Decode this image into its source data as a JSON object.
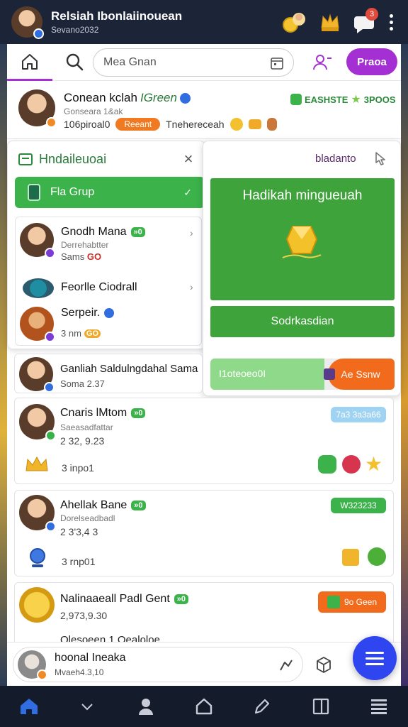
{
  "header": {
    "title": "Relsiah Ibonlaiinouean",
    "subtitle": "Sevano2032",
    "notification_count": "3"
  },
  "search": {
    "placeholder": "Mea Gnan",
    "primary_button": "Praoa"
  },
  "profile": {
    "name": "Conean kclah",
    "name_accent": "IGreen",
    "sub": "Gonseara 1&ak",
    "stats": "106piroal0",
    "badge": "Reeant",
    "extra": "Tnehereceah",
    "right_tag_1": "EASHSTE",
    "right_tag_2": "3POOS"
  },
  "group_popup": {
    "title": "Hndaileuoai",
    "group_button": "Fla Grup",
    "members": [
      {
        "name": "Gnodh Mana",
        "tag": "»0",
        "sub1": "Derrehabtter",
        "sub2": "Sams",
        "sub2_accent": "GO"
      },
      {
        "name": "Feorlle Ciodrall"
      },
      {
        "name": "Serpeir.",
        "sub2": "3 nm",
        "sub2_accent": "GO"
      }
    ]
  },
  "reward_popup": {
    "header": "bladanto",
    "banner_title": "Hadikah mingueuah",
    "action_label": "Sodrkasdian",
    "progress_label": "I1oteoeo0I",
    "progress_fraction": 0.62,
    "cta_label": "Ae Ssnw"
  },
  "feed": [
    {
      "name": "Ganliah Saldulngdahal Sama",
      "sub": "Soma 2.37"
    },
    {
      "name": "Cnaris lMtom",
      "tag": "»0",
      "sub1": "Saeasadfattar",
      "sub2": "2 32, 9.23",
      "right_badge": "7a3 3a3a66",
      "meta": "3 inpo1"
    },
    {
      "name": "Ahellak Bane",
      "tag": "»0",
      "sub1": "Dorelseadbadl",
      "sub2": "2 3'3,4 3",
      "right_badge": "W323233",
      "meta": "3 rnp01"
    },
    {
      "name": "Nalinaaeall Padl Gent",
      "tag": "»0",
      "sub2": "2,973,9.30",
      "right_badge": "9o Geen",
      "next_name": "Olesoeen 1 Oealoloe"
    }
  ],
  "bottom_user": {
    "name": "hoonal Ineaka",
    "sub": "Mvaeh4.3,10"
  },
  "colors": {
    "accent_purple": "#a42fd2",
    "green": "#3bb24a",
    "orange": "#f26b1d",
    "blue": "#2f55f0",
    "header_bg": "#1c2438"
  }
}
